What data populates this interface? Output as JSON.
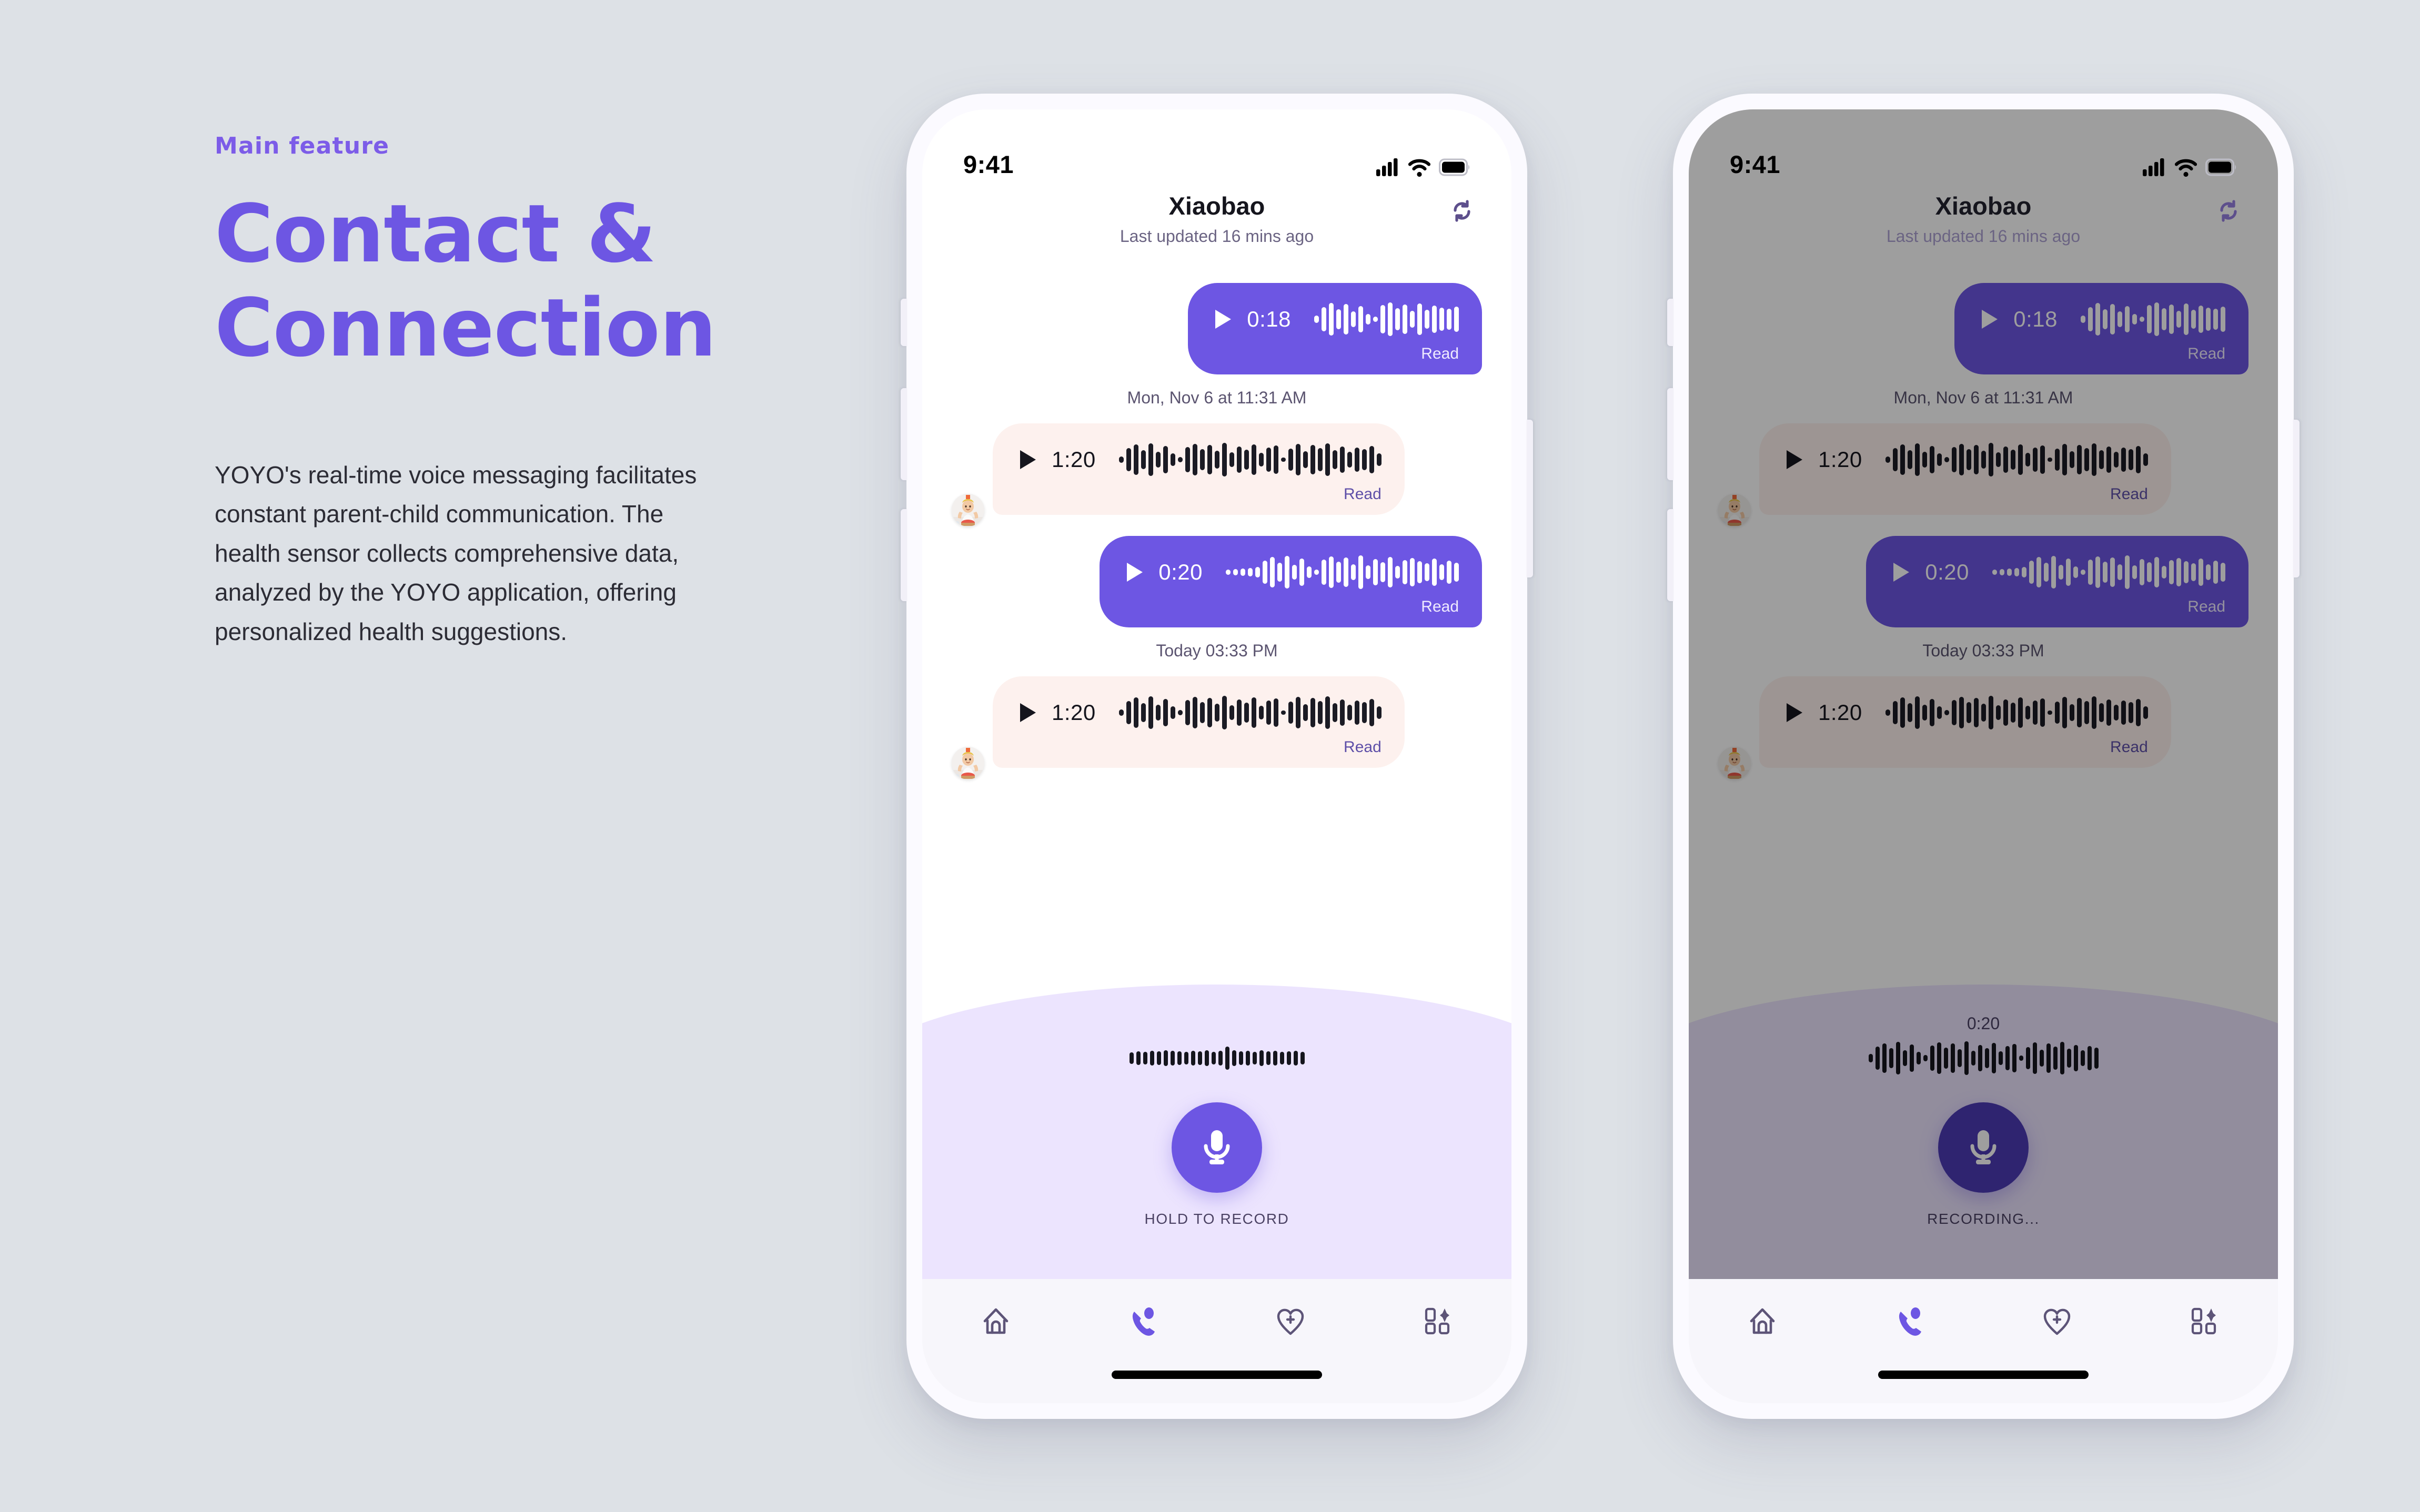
{
  "theme": {
    "page_bg": "#dde1e6",
    "accent": "#6d56e3",
    "accent_light": "#7c5ce8",
    "bubble_in_bg": "#fdf1ee",
    "record_panel_bg": "#ece4fe",
    "tabbar_bg": "#f7f6fb",
    "mic_active": "#4c3ab5"
  },
  "copy": {
    "eyebrow": "Main feature",
    "headline_line1": "Contact &",
    "headline_line2": "Connection",
    "body": "YOYO's real-time voice messaging facilitates constant parent-child communication. The health sensor collects comprehensive data, analyzed by the YOYO application, offering personalized health suggestions."
  },
  "phones": [
    {
      "id": "phone-idle",
      "dimmed": false,
      "status_bar": {
        "time": "9:41",
        "icons": [
          "cellular-signal-icon",
          "wifi-icon",
          "battery-icon"
        ]
      },
      "header": {
        "title": "Xiaobao",
        "subtitle": "Last updated 16 mins ago",
        "refresh_icon": "refresh-icon"
      },
      "messages": [
        {
          "kind": "voice",
          "direction": "out",
          "duration": "0:18",
          "status": "Read",
          "avatar": false
        },
        {
          "kind": "timestamp",
          "text": "Mon, Nov 6 at 11:31 AM"
        },
        {
          "kind": "voice",
          "direction": "in",
          "duration": "1:20",
          "status": "Read",
          "avatar": true
        },
        {
          "kind": "voice",
          "direction": "out",
          "duration": "0:20",
          "status": "Read",
          "avatar": false
        },
        {
          "kind": "timestamp",
          "text": "Today 03:33 PM"
        },
        {
          "kind": "voice",
          "direction": "in",
          "duration": "1:20",
          "status": "Read",
          "avatar": true
        }
      ],
      "record": {
        "timer": "",
        "label": "HOLD TO RECORD",
        "mic_icon": "microphone-icon",
        "recording": false
      },
      "tabs": [
        {
          "name": "home",
          "icon": "home-icon",
          "active": false
        },
        {
          "name": "contact",
          "icon": "phone-call-icon",
          "active": true
        },
        {
          "name": "health",
          "icon": "heart-plus-icon",
          "active": false
        },
        {
          "name": "more",
          "icon": "grid-sparkle-icon",
          "active": false
        }
      ]
    },
    {
      "id": "phone-recording",
      "dimmed": true,
      "status_bar": {
        "time": "9:41",
        "icons": [
          "cellular-signal-icon",
          "wifi-icon",
          "battery-icon"
        ]
      },
      "header": {
        "title": "Xiaobao",
        "subtitle": "Last updated 16 mins ago",
        "refresh_icon": "refresh-icon"
      },
      "messages": [
        {
          "kind": "voice",
          "direction": "out",
          "duration": "0:18",
          "status": "Read",
          "avatar": false
        },
        {
          "kind": "timestamp",
          "text": "Mon, Nov 6 at 11:31 AM"
        },
        {
          "kind": "voice",
          "direction": "in",
          "duration": "1:20",
          "status": "Read",
          "avatar": true
        },
        {
          "kind": "voice",
          "direction": "out",
          "duration": "0:20",
          "status": "Read",
          "avatar": false
        },
        {
          "kind": "timestamp",
          "text": "Today 03:33 PM"
        },
        {
          "kind": "voice",
          "direction": "in",
          "duration": "1:20",
          "status": "Read",
          "avatar": true
        }
      ],
      "record": {
        "timer": "0:20",
        "label": "RECORDING...",
        "mic_icon": "microphone-icon",
        "recording": true
      },
      "tabs": [
        {
          "name": "home",
          "icon": "home-icon",
          "active": false
        },
        {
          "name": "contact",
          "icon": "phone-call-icon",
          "active": true
        },
        {
          "name": "health",
          "icon": "heart-plus-icon",
          "active": false
        },
        {
          "name": "more",
          "icon": "grid-sparkle-icon",
          "active": false
        }
      ]
    }
  ],
  "waveforms": {
    "out_018": [
      14,
      46,
      62,
      38,
      58,
      30,
      50,
      20,
      10,
      54,
      64,
      42,
      56,
      32,
      60,
      36,
      52,
      44,
      40,
      48
    ],
    "in_120": [
      12,
      44,
      58,
      36,
      62,
      30,
      52,
      24,
      10,
      48,
      60,
      40,
      56,
      34,
      64,
      28,
      50,
      38,
      58,
      26,
      46,
      54,
      8,
      42,
      60,
      32,
      56,
      44,
      62,
      36,
      50,
      30,
      46,
      40,
      52,
      24
    ],
    "out_020": [
      10,
      12,
      14,
      16,
      20,
      44,
      58,
      36,
      62,
      28,
      52,
      22,
      10,
      48,
      60,
      40,
      56,
      30,
      64,
      26,
      50,
      38,
      58,
      24,
      46,
      54,
      42,
      34,
      52,
      30,
      44,
      36
    ],
    "record_idle": [
      22,
      26,
      24,
      28,
      26,
      30,
      28,
      26,
      24,
      28,
      26,
      30,
      24,
      28,
      44,
      30,
      26,
      28,
      24,
      30,
      26,
      28,
      24,
      26,
      28,
      24
    ],
    "record_active": [
      16,
      44,
      56,
      38,
      62,
      30,
      52,
      24,
      12,
      48,
      60,
      40,
      56,
      34,
      64,
      28,
      50,
      38,
      58,
      26,
      46,
      54,
      10,
      42,
      60,
      32,
      56,
      44,
      62,
      36,
      50,
      30,
      46,
      40
    ]
  }
}
